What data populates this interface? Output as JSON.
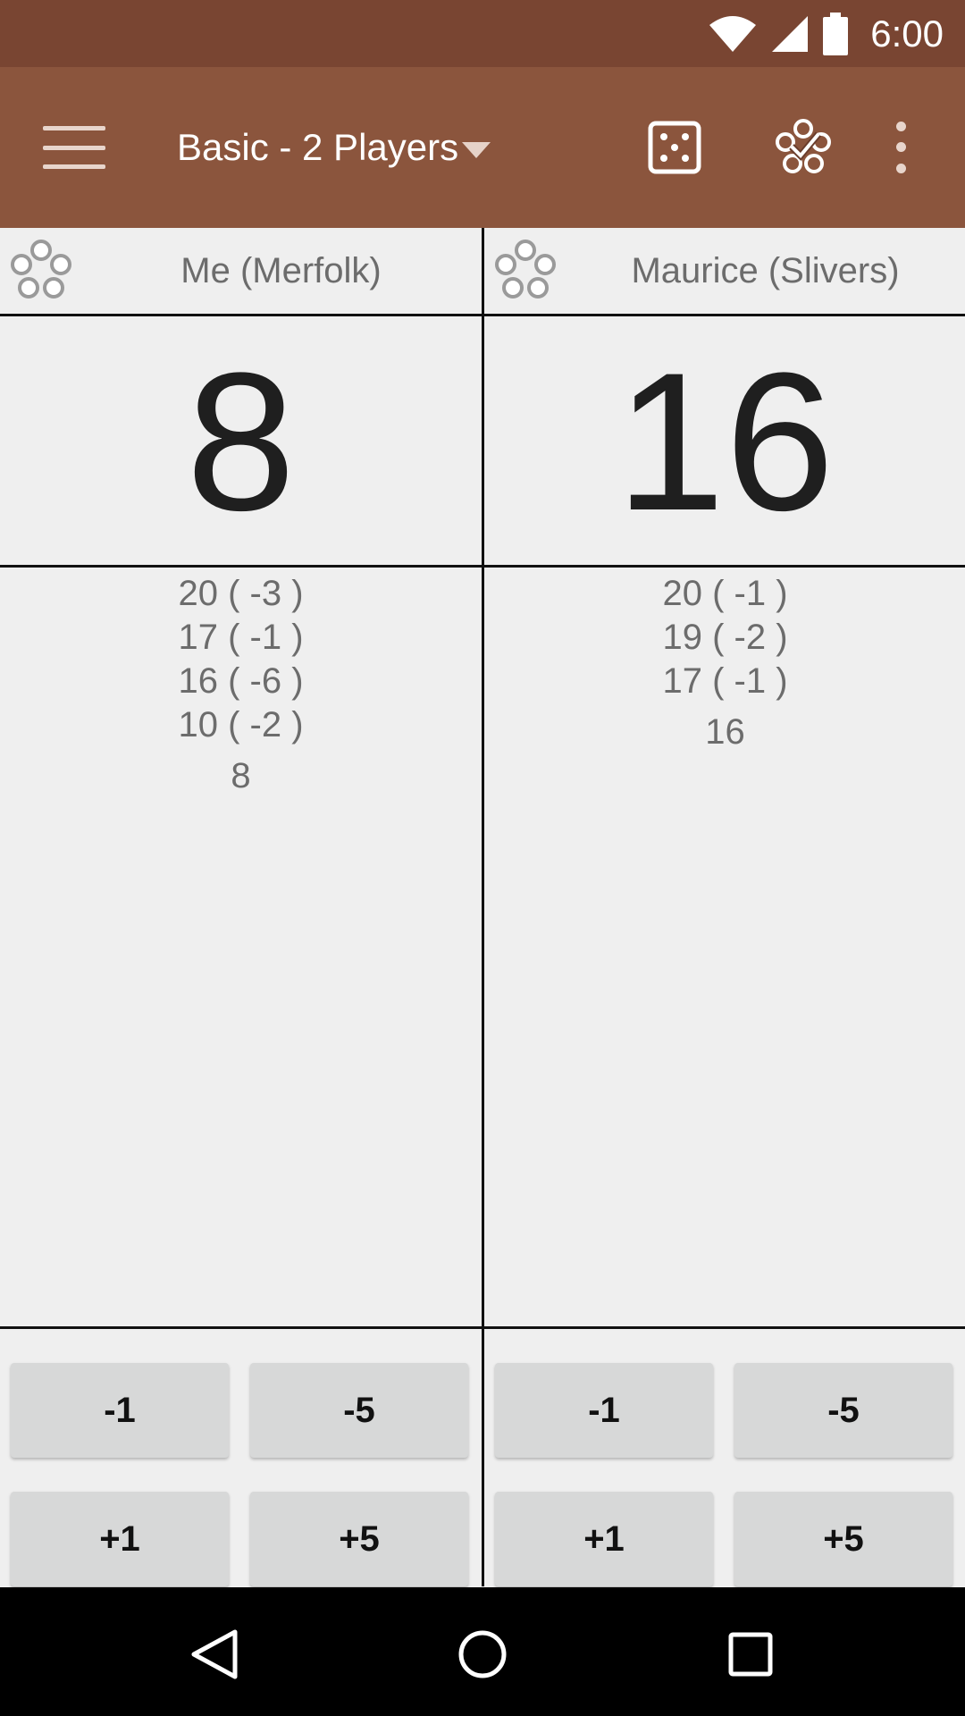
{
  "status_bar": {
    "time": "6:00",
    "icons": [
      "wifi-icon",
      "signal-icon",
      "battery-icon"
    ]
  },
  "app_bar": {
    "title": "Basic - 2 Players",
    "icons": [
      "menu-icon",
      "dropdown-caret-icon",
      "dice-icon",
      "flower-check-icon",
      "overflow-menu-icon"
    ]
  },
  "players": [
    {
      "name": "Me (Merfolk)",
      "life": "8",
      "history": [
        "20 ( -3 )",
        "17 ( -1 )",
        "16 ( -6 )",
        "10 ( -2 )"
      ],
      "current": "8",
      "buttons": [
        "-1",
        "-5",
        "+1",
        "+5"
      ]
    },
    {
      "name": "Maurice (Slivers)",
      "life": "16",
      "history": [
        "20 ( -1 )",
        "19 ( -2 )",
        "17 ( -1 )"
      ],
      "current": "16",
      "buttons": [
        "-1",
        "-5",
        "+1",
        "+5"
      ]
    }
  ],
  "nav_bar": {
    "icons": [
      "back-icon",
      "home-icon",
      "recents-icon"
    ]
  },
  "colors": {
    "status_bar": "#794532",
    "app_bar": "#8b553d",
    "background": "#efefef",
    "button": "#d7d8d8"
  }
}
